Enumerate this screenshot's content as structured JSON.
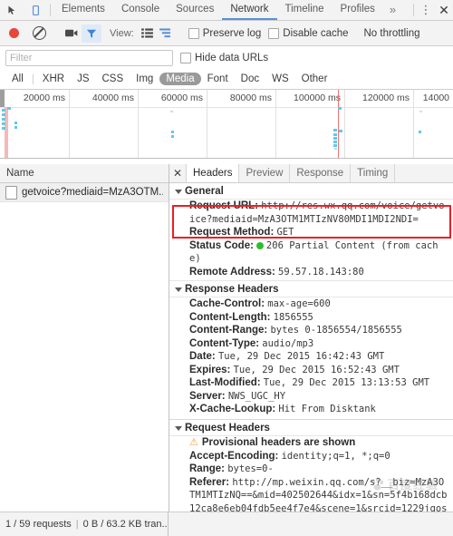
{
  "devtools": {
    "icons": {
      "inspect": "inspect-cursor-icon",
      "device": "device-toolbar-icon"
    },
    "tabs": [
      {
        "label": "Elements",
        "active": false
      },
      {
        "label": "Console",
        "active": false
      },
      {
        "label": "Sources",
        "active": false
      },
      {
        "label": "Network",
        "active": true
      },
      {
        "label": "Timeline",
        "active": false
      },
      {
        "label": "Profiles",
        "active": false
      }
    ],
    "more_tabs_label": "»",
    "menu_label": "⋮",
    "close_label": "✕",
    "accent_color": "#5a8ed6"
  },
  "network_toolbar": {
    "record_title": "record-button",
    "clear_title": "clear-button",
    "capture_screenshots_title": "camera-icon",
    "filter_title": "filter-icon",
    "view_label": "View:",
    "view_list_title": "list-view-icon",
    "view_waterfall_title": "waterfall-view-icon",
    "preserve_log_label": "Preserve log",
    "preserve_log_checked": false,
    "disable_cache_label": "Disable cache",
    "disable_cache_checked": false,
    "throttling_label": "No throttling",
    "filter_active_color": "#dfeaf7"
  },
  "filter_bar": {
    "filter_value": "",
    "filter_placeholder": "Filter",
    "hide_data_urls_label": "Hide data URLs",
    "hide_data_urls_checked": false
  },
  "type_filters": {
    "items": [
      {
        "label": "All",
        "selected": false
      },
      {
        "label": "XHR",
        "selected": false
      },
      {
        "label": "JS",
        "selected": false
      },
      {
        "label": "CSS",
        "selected": false
      },
      {
        "label": "Img",
        "selected": false
      },
      {
        "label": "Media",
        "selected": true
      },
      {
        "label": "Font",
        "selected": false
      },
      {
        "label": "Doc",
        "selected": false
      },
      {
        "label": "WS",
        "selected": false
      },
      {
        "label": "Other",
        "selected": false
      }
    ],
    "selected_bg": "#9a9a9a"
  },
  "overview": {
    "tick_labels": [
      "20000 ms",
      "40000 ms",
      "60000 ms",
      "80000 ms",
      "100000 ms",
      "120000 ms",
      "14000"
    ],
    "marker_color": "#f07070",
    "event_color": "#62c8e8"
  },
  "request_list": {
    "column_header": "Name",
    "rows": [
      {
        "name": "getvoice?mediaid=MzA3OTM...",
        "selected": true
      }
    ]
  },
  "detail": {
    "close_label": "✕",
    "tabs": [
      {
        "label": "Headers",
        "active": true
      },
      {
        "label": "Preview",
        "active": false
      },
      {
        "label": "Response",
        "active": false
      },
      {
        "label": "Timing",
        "active": false
      }
    ],
    "sections": [
      {
        "title": "General",
        "highlight": true,
        "rows": [
          {
            "key": "Request URL:",
            "value": "http://res.wx.qq.com/voice/getvoice?mediaid=MzA3OTM1MTIzNV80MDI1MDI2NDI="
          },
          {
            "key": "Request Method:",
            "value": "GET"
          },
          {
            "key": "Status Code:",
            "value": "206 Partial Content (from cache)",
            "status_dot": true,
            "status_color": "#2fbd2f"
          },
          {
            "key": "Remote Address:",
            "value": "59.57.18.143:80"
          }
        ]
      },
      {
        "title": "Response Headers",
        "rows": [
          {
            "key": "Cache-Control:",
            "value": "max-age=600"
          },
          {
            "key": "Content-Length:",
            "value": "1856555"
          },
          {
            "key": "Content-Range:",
            "value": "bytes 0-1856554/1856555"
          },
          {
            "key": "Content-Type:",
            "value": "audio/mp3"
          },
          {
            "key": "Date:",
            "value": "Tue, 29 Dec 2015 16:42:43 GMT"
          },
          {
            "key": "Expires:",
            "value": "Tue, 29 Dec 2015 16:52:43 GMT"
          },
          {
            "key": "Last-Modified:",
            "value": "Tue, 29 Dec 2015 13:13:53 GMT"
          },
          {
            "key": "Server:",
            "value": "NWS_UGC_HY"
          },
          {
            "key": "X-Cache-Lookup:",
            "value": "Hit From Disktank"
          }
        ]
      },
      {
        "title": "Request Headers",
        "warning": "Provisional headers are shown",
        "rows": [
          {
            "key": "Accept-Encoding:",
            "value": "identity;q=1, *;q=0"
          },
          {
            "key": "Range:",
            "value": "bytes=0-"
          },
          {
            "key": "Referer:",
            "value": "http://mp.weixin.qq.com/s?__biz=MzA3OTM1MTIzNQ==&mid=402502644&idx=1&sn=5f4b168dcb12ca8e6eb04fdb5ee4f7e4&scene=1&srcid=1229jqos61jwfK"
          }
        ]
      }
    ],
    "highlight_color": "#ee1c25"
  },
  "watermark": {
    "text": "百度经验"
  },
  "statusbar": {
    "requests_text": "1 / 59 requests",
    "separator": "|",
    "transfer_text": "0 B / 63.2 KB tran..."
  }
}
